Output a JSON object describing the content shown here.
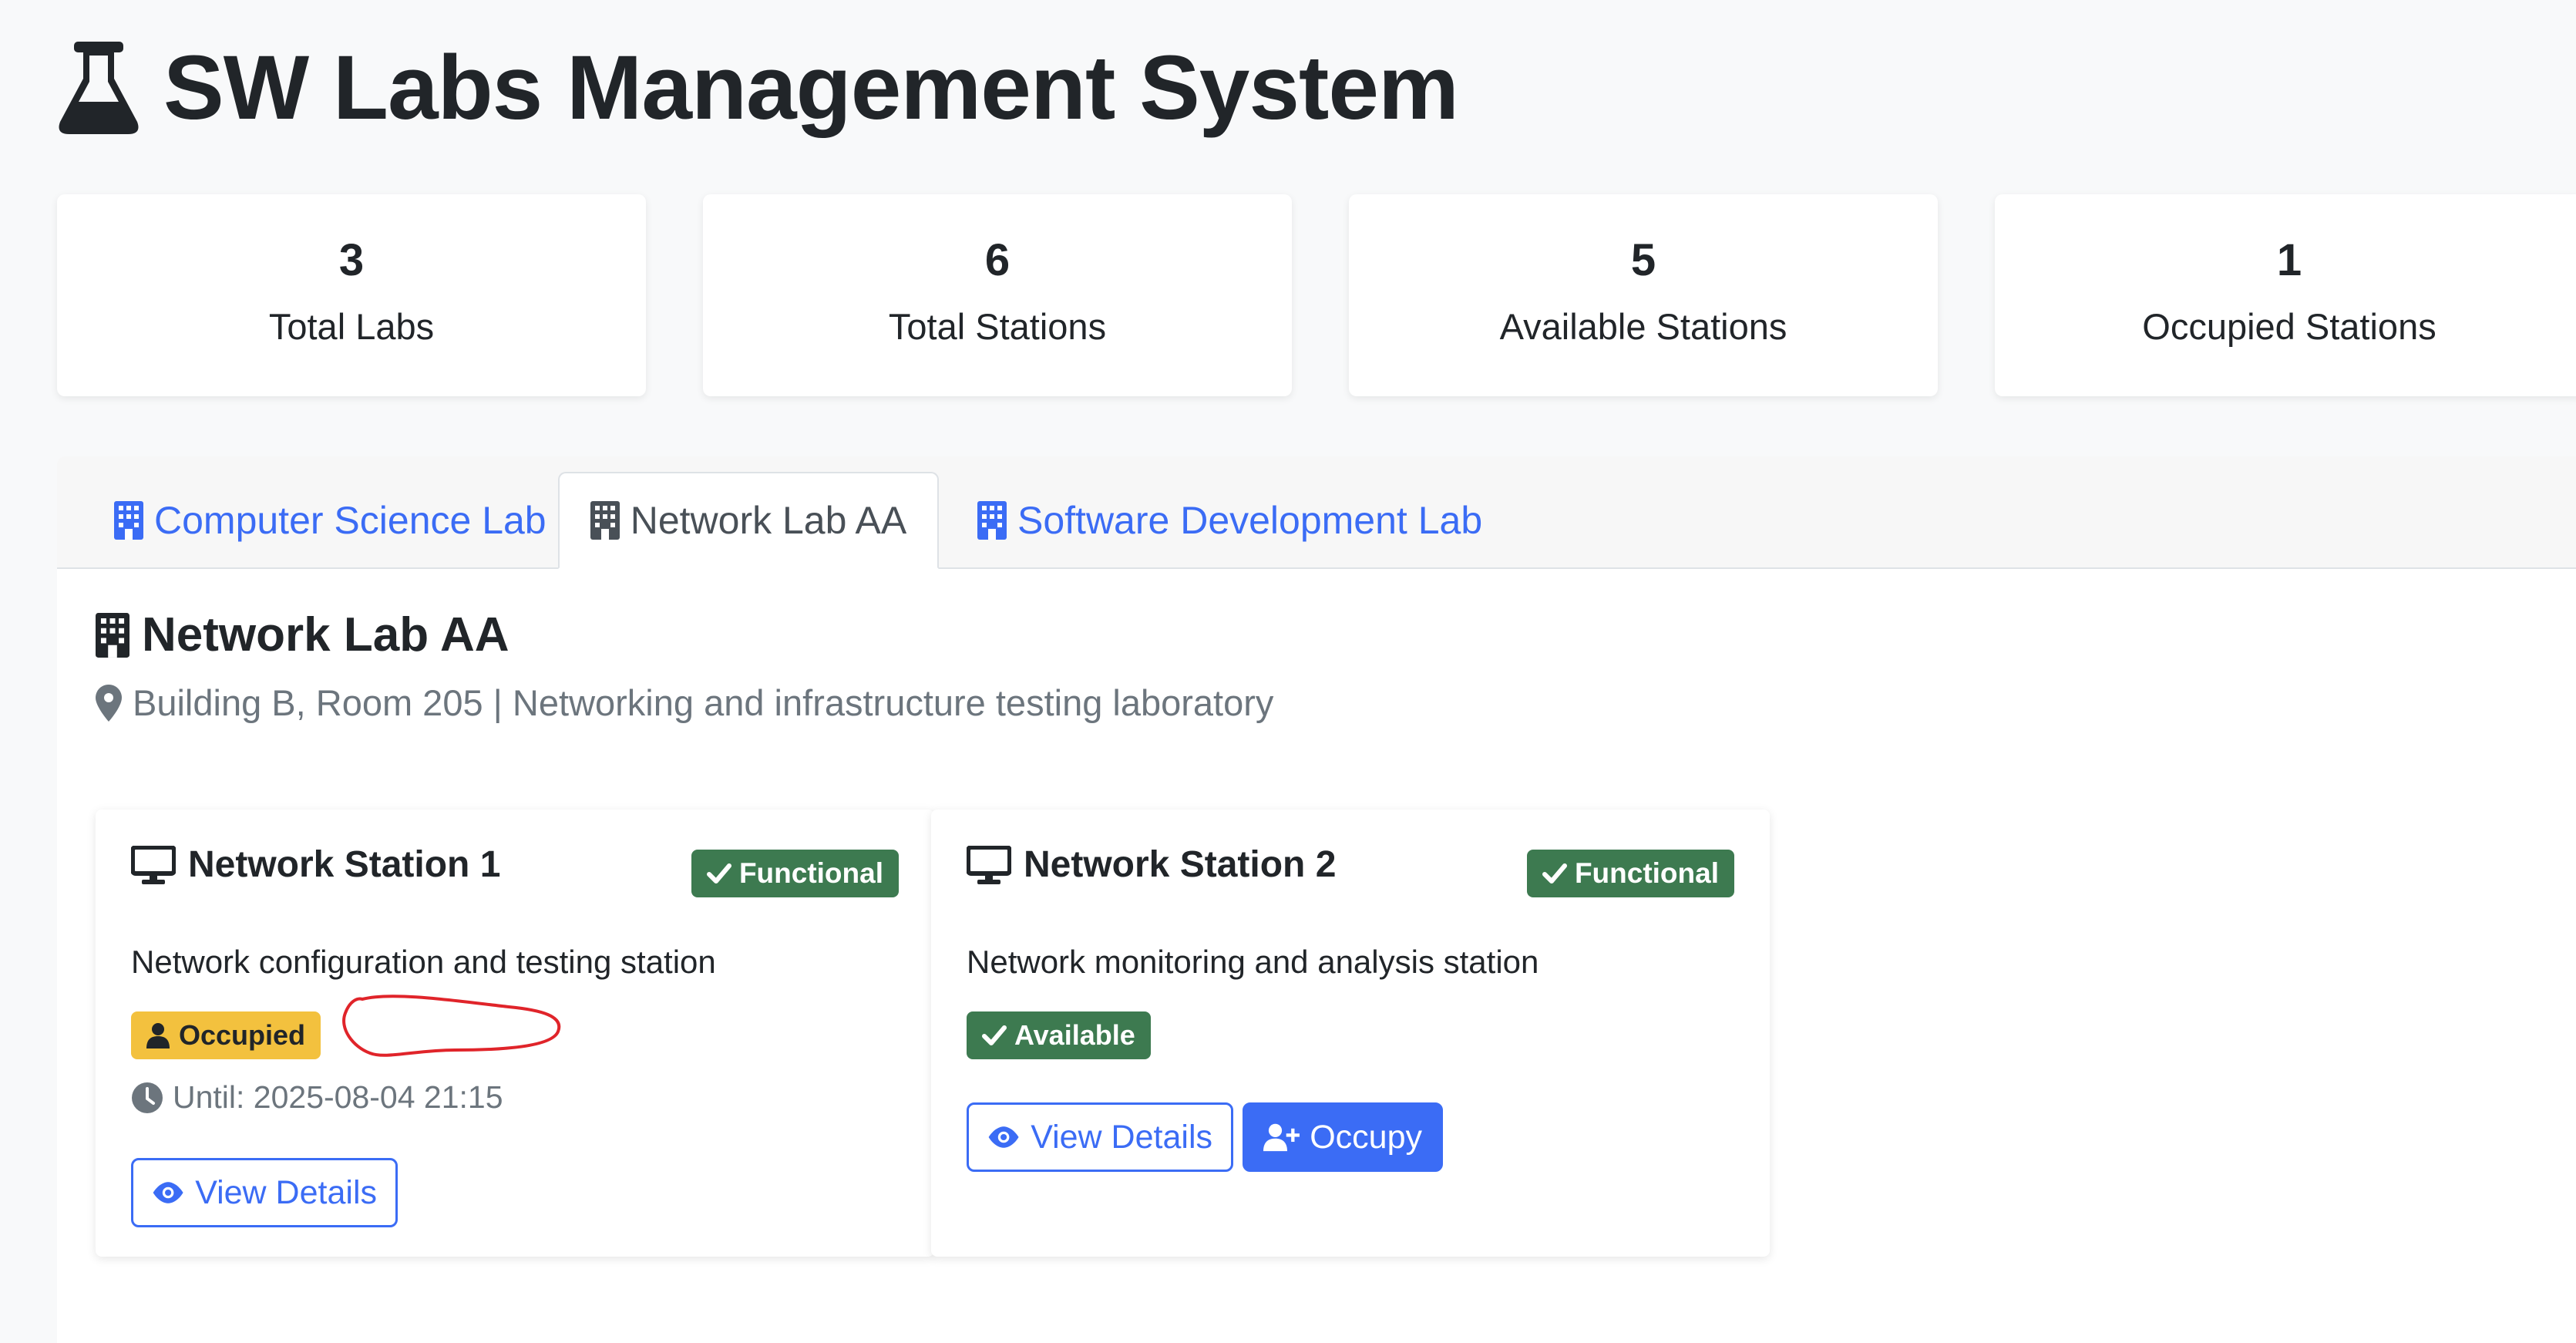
{
  "app": {
    "title": "SW Labs Management System",
    "icon": "flask-icon"
  },
  "stats": [
    {
      "value": "3",
      "label": "Total Labs"
    },
    {
      "value": "6",
      "label": "Total Stations"
    },
    {
      "value": "5",
      "label": "Available Stations"
    },
    {
      "value": "1",
      "label": "Occupied Stations"
    }
  ],
  "tabs": [
    {
      "label": "Computer Science Lab",
      "icon": "building-icon",
      "active": false
    },
    {
      "label": "Network Lab AA",
      "icon": "building-icon",
      "active": true
    },
    {
      "label": "Software Development Lab",
      "icon": "building-icon",
      "active": false
    }
  ],
  "lab": {
    "name": "Network Lab AA",
    "meta": "Building B, Room 205 | Networking and infrastructure testing laboratory"
  },
  "stations": [
    {
      "name": "Network Station 1",
      "condition": "Functional",
      "description": "Network configuration and testing station",
      "status": "Occupied",
      "until": "Until: 2025-08-04 21:15",
      "view_label": "View Details"
    },
    {
      "name": "Network Station 2",
      "condition": "Functional",
      "description": "Network monitoring and analysis station",
      "status": "Available",
      "view_label": "View Details",
      "occupy_label": "Occupy"
    }
  ],
  "colors": {
    "primary": "#3b6cf5",
    "functional": "#3d7a50",
    "occupied": "#f3c13e",
    "annotation": "#e0242a"
  }
}
